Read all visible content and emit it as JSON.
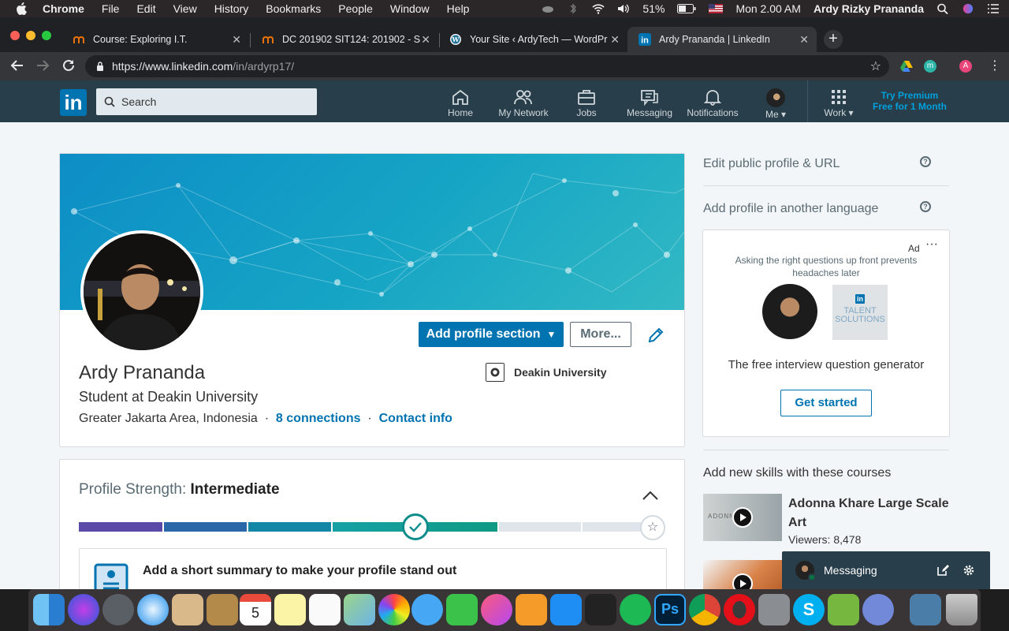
{
  "menubar": {
    "app": "Chrome",
    "items": [
      "File",
      "Edit",
      "View",
      "History",
      "Bookmarks",
      "People",
      "Window",
      "Help"
    ],
    "battery": "51%",
    "clock": "Mon 2.00 AM",
    "user": "Ardy Rizky Prananda"
  },
  "tabs": [
    {
      "title": "Course: Exploring I.T.",
      "favicon_color": "#e8710a"
    },
    {
      "title": "DC 201902 SIT124: 201902 - S",
      "favicon_color": "#e8710a"
    },
    {
      "title": "Your Site ‹ ArdyTech — WordPr",
      "favicon_color": "#f1f1f1"
    },
    {
      "title": "Ardy Prananda | LinkedIn",
      "favicon_color": "#0073b1"
    }
  ],
  "address": {
    "host": "https://www.linkedin.com",
    "path": "/in/ardyrp17/"
  },
  "linkedin_nav": {
    "logo": "in",
    "search_placeholder": "Search",
    "items": [
      {
        "label": "Home",
        "icon": "home-icon"
      },
      {
        "label": "My Network",
        "icon": "network-icon"
      },
      {
        "label": "Jobs",
        "icon": "briefcase-icon"
      },
      {
        "label": "Messaging",
        "icon": "messaging-icon"
      },
      {
        "label": "Notifications",
        "icon": "bell-icon"
      },
      {
        "label": "Me",
        "icon": "avatar"
      },
      {
        "label": "Work",
        "icon": "grid-icon"
      }
    ],
    "premium_line1": "Try Premium",
    "premium_line2": "Free for 1 Month"
  },
  "profile": {
    "name": "Ardy Prananda",
    "headline": "Student at Deakin University",
    "location": "Greater Jakarta Area, Indonesia",
    "connections": "8 connections",
    "contact": "Contact info",
    "education": "Deakin University",
    "add_section_label": "Add profile section",
    "more_label": "More..."
  },
  "profile_strength": {
    "label": "Profile Strength:",
    "level": "Intermediate",
    "progress_fraction": 0.71,
    "tip_title": "Add a short summary to make your profile stand out"
  },
  "rail": {
    "edit_public": "Edit public profile & URL",
    "add_language": "Add profile in another language",
    "ad": {
      "tag": "Ad",
      "text": "Asking the right questions up front prevents headaches later",
      "brand_line1": "TALENT",
      "brand_line2": "SOLUTIONS",
      "headline": "The free interview question generator",
      "cta": "Get started"
    },
    "courses_title": "Add new skills with these courses",
    "courses": [
      {
        "title": "Adonna Khare Large Scale Art",
        "viewers": "Viewers: 8,478",
        "thumb_text": "ADONN"
      }
    ]
  },
  "messaging": {
    "label": "Messaging"
  },
  "colors": {
    "linkedin_blue": "#0073b1",
    "nav_bg": "#283e4a",
    "page_bg": "#f3f6f8"
  }
}
